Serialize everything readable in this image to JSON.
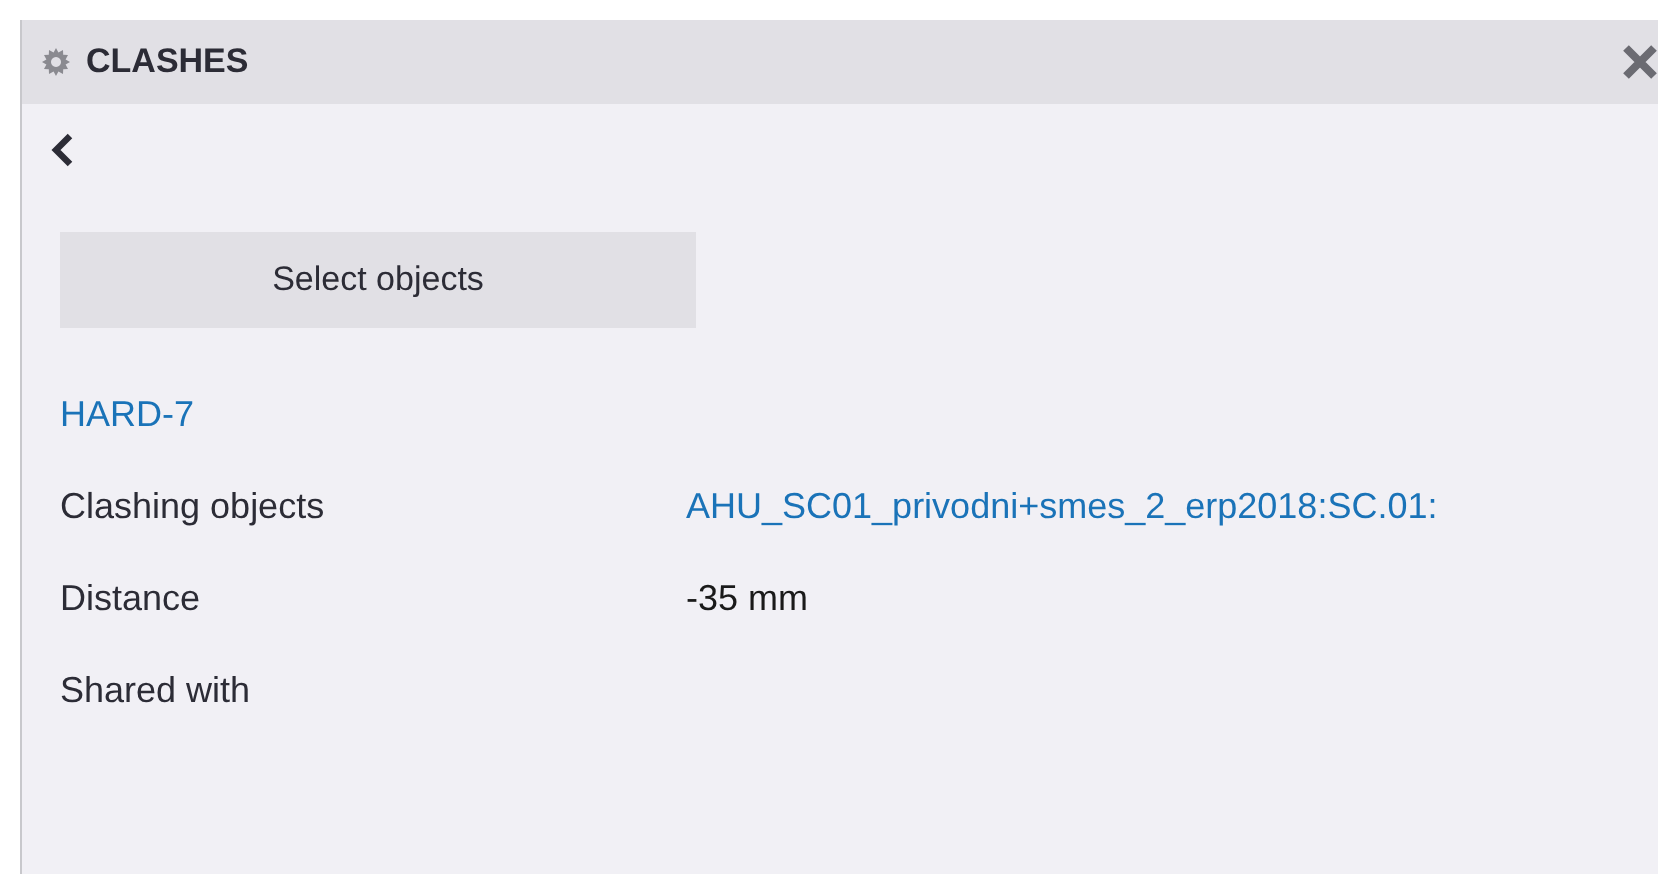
{
  "panel": {
    "title": "CLASHES"
  },
  "select_button": {
    "label": "Select objects"
  },
  "clash": {
    "name": "HARD-7"
  },
  "properties": [
    {
      "label": "Clashing objects",
      "value": "AHU_SC01_privodni+smes_2_erp2018:SC.01:",
      "kind": "link"
    },
    {
      "label": "Distance",
      "value": "-35 mm",
      "kind": "text"
    },
    {
      "label": "Shared with"
    }
  ]
}
